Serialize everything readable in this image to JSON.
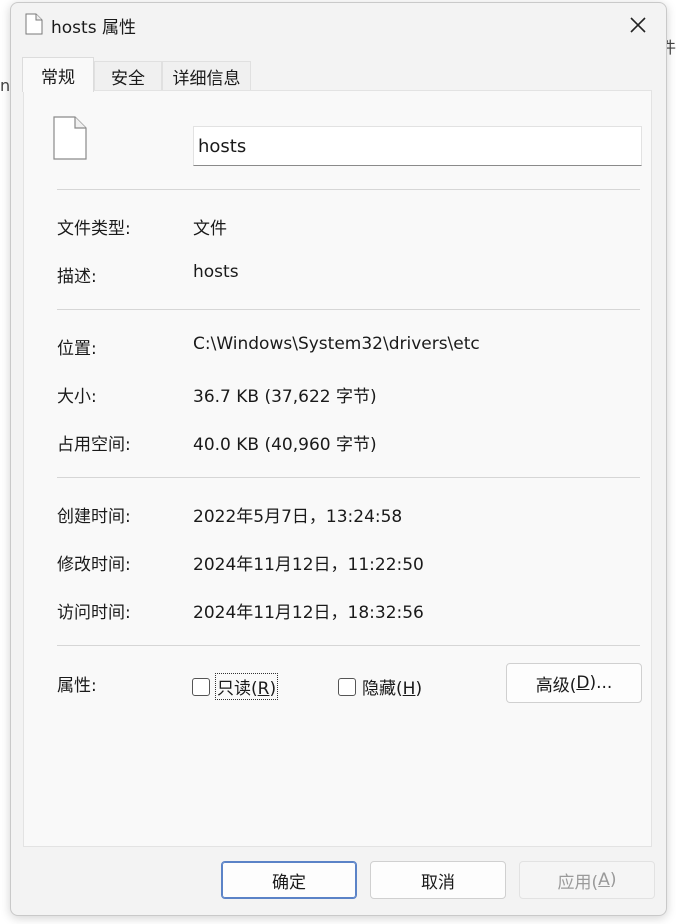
{
  "background": {
    "left_char": "n",
    "right_char": "件"
  },
  "window": {
    "title": "hosts 属性",
    "close_label": "×"
  },
  "tabs": [
    {
      "label": "常规",
      "active": true
    },
    {
      "label": "安全",
      "active": false
    },
    {
      "label": "详细信息",
      "active": false
    }
  ],
  "general": {
    "file_name": "hosts",
    "type_label": "文件类型:",
    "type_value": "文件",
    "desc_label": "描述:",
    "desc_value": "hosts",
    "location_label": "位置:",
    "location_value": "C:\\Windows\\System32\\drivers\\etc",
    "size_label": "大小:",
    "size_value": "36.7 KB (37,622 字节)",
    "disk_label": "占用空间:",
    "disk_value": "40.0 KB (40,960 字节)",
    "created_label": "创建时间:",
    "created_value": "2022年5月7日，13:24:58",
    "modified_label": "修改时间:",
    "modified_value": "2024年11月12日，11:22:50",
    "accessed_label": "访问时间:",
    "accessed_value": "2024年11月12日，18:32:56",
    "attr_label": "属性:",
    "readonly_text": "只读(",
    "readonly_key": "R",
    "readonly_end": ")",
    "readonly_checked": false,
    "hidden_text": "隐藏(",
    "hidden_key": "H",
    "hidden_end": ")",
    "hidden_checked": false,
    "advanced_text": "高级(",
    "advanced_key": "D",
    "advanced_end": ")..."
  },
  "footer": {
    "ok_label": "确定",
    "cancel_label": "取消",
    "apply_text": "应用(",
    "apply_key": "A",
    "apply_end": ")",
    "apply_enabled": false
  },
  "colors": {
    "primary_border": "#5b83c7",
    "window_bg": "#f3f3f3",
    "panel_bg": "#f9f9f9"
  }
}
